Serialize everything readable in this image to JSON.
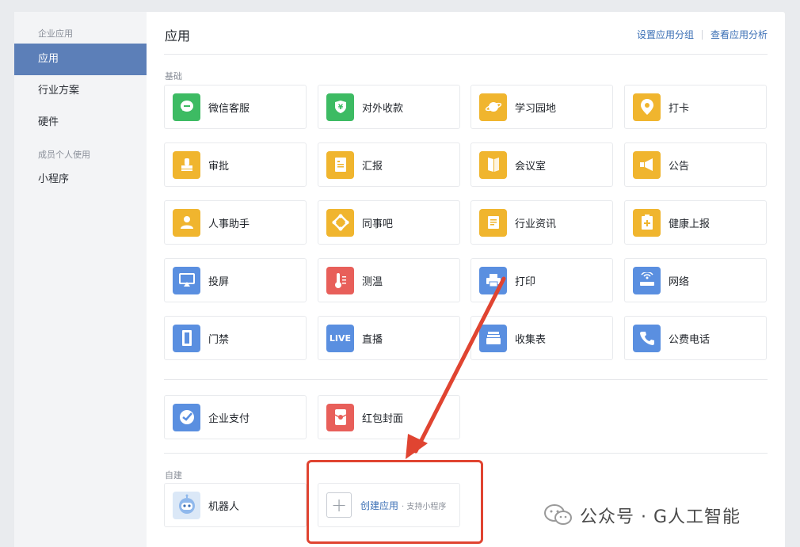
{
  "sidebar": {
    "group1": "企业应用",
    "item_apps": "应用",
    "item_industry": "行业方案",
    "item_hardware": "硬件",
    "group2": "成员个人使用",
    "item_miniprogram": "小程序"
  },
  "header": {
    "title": "应用",
    "link_group": "设置应用分组",
    "link_analysis": "查看应用分析"
  },
  "sections": {
    "basic": "基础",
    "custom": "自建"
  },
  "apps": [
    {
      "label": "微信客服",
      "icon": "wechat-service-icon",
      "color": "#3dbb63"
    },
    {
      "label": "对外收款",
      "icon": "yuan-shield-icon",
      "color": "#3dbb63"
    },
    {
      "label": "学习园地",
      "icon": "planet-icon",
      "color": "#f0b52e"
    },
    {
      "label": "打卡",
      "icon": "location-pin-icon",
      "color": "#f0b52e"
    },
    {
      "label": "审批",
      "icon": "stamp-icon",
      "color": "#f0b52e"
    },
    {
      "label": "汇报",
      "icon": "report-icon",
      "color": "#f0b52e"
    },
    {
      "label": "会议室",
      "icon": "door-icon",
      "color": "#f0b52e"
    },
    {
      "label": "公告",
      "icon": "megaphone-icon",
      "color": "#f0b52e"
    },
    {
      "label": "人事助手",
      "icon": "person-icon",
      "color": "#f0b52e"
    },
    {
      "label": "同事吧",
      "icon": "network-icon",
      "color": "#f0b52e"
    },
    {
      "label": "行业资讯",
      "icon": "news-icon",
      "color": "#f0b52e"
    },
    {
      "label": "健康上报",
      "icon": "health-clipboard-icon",
      "color": "#f0b52e"
    },
    {
      "label": "投屏",
      "icon": "screen-cast-icon",
      "color": "#5a8fe0"
    },
    {
      "label": "测温",
      "icon": "thermometer-icon",
      "color": "#e85f5a"
    },
    {
      "label": "打印",
      "icon": "printer-icon",
      "color": "#5a8fe0"
    },
    {
      "label": "网络",
      "icon": "router-icon",
      "color": "#5a8fe0"
    },
    {
      "label": "门禁",
      "icon": "access-door-icon",
      "color": "#5a8fe0"
    },
    {
      "label": "直播",
      "icon": "live-icon",
      "color": "#5a8fe0",
      "text": "LIVE"
    },
    {
      "label": "收集表",
      "icon": "form-tray-icon",
      "color": "#5a8fe0"
    },
    {
      "label": "公费电话",
      "icon": "phone-icon",
      "color": "#5a8fe0"
    }
  ],
  "pay_apps": [
    {
      "label": "企业支付",
      "icon": "wepay-icon",
      "color": "#5a8fe0"
    },
    {
      "label": "红包封面",
      "icon": "red-packet-icon",
      "color": "#e85f5a"
    }
  ],
  "custom_apps": [
    {
      "label": "机器人",
      "icon": "robot-icon"
    }
  ],
  "create": {
    "label": "创建应用",
    "sub": "· 支持小程序"
  },
  "watermark": "公众号 · G人工智能",
  "colors": {
    "accent": "#5c7fb8",
    "link": "#3b6fb5",
    "highlight": "#e04431"
  }
}
